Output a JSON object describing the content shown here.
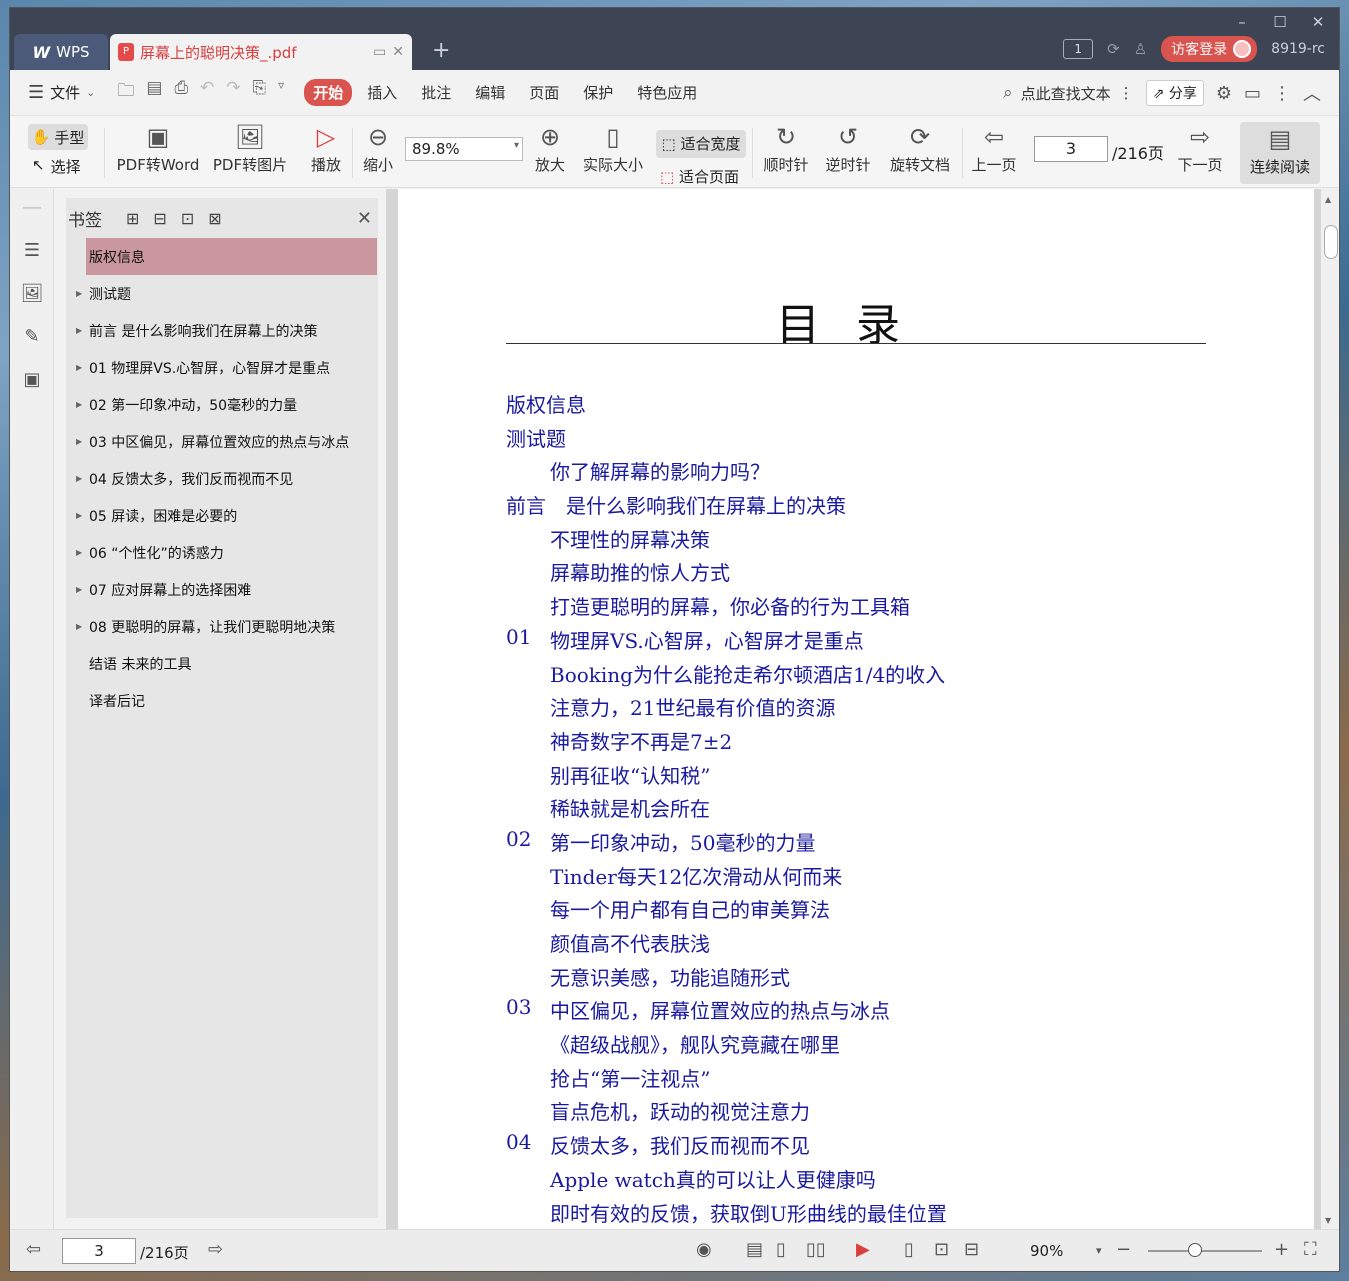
{
  "titlebar": {
    "app_tab": "WPS",
    "doc_tab": "屏幕上的聪明决策_.pdf",
    "page_badge": "1",
    "login": "访客登录",
    "user": "8919-rc"
  },
  "menubar": {
    "file": "文件",
    "menus": [
      "开始",
      "插入",
      "批注",
      "编辑",
      "页面",
      "保护",
      "特色应用"
    ],
    "active_menu": "开始",
    "search": "点此查找文本",
    "share": "分享"
  },
  "toolbar": {
    "hand": "手型",
    "select": "选择",
    "pdf2word": "PDF转Word",
    "pdf2img": "PDF转图片",
    "play": "播放",
    "zoom_out": "缩小",
    "zoom_value": "89.8%",
    "zoom_in": "放大",
    "actual_size": "实际大小",
    "fit_width": "适合宽度",
    "fit_page": "适合页面",
    "clockwise": "顺时针",
    "counter": "逆时针",
    "rotate_doc": "旋转文档",
    "prev": "上一页",
    "page": "3",
    "total": "/216页",
    "next": "下一页",
    "continuous": "连续阅读"
  },
  "bookmarks": {
    "title": "书签",
    "items": [
      {
        "label": "版权信息",
        "arrow": false,
        "selected": true
      },
      {
        "label": "测试题",
        "arrow": true
      },
      {
        "label": "前言 是什么影响我们在屏幕上的决策",
        "arrow": true
      },
      {
        "label": "01 物理屏VS.心智屏，心智屏才是重点",
        "arrow": true
      },
      {
        "label": "02 第一印象冲动，50毫秒的力量",
        "arrow": true
      },
      {
        "label": "03 中区偏见，屏幕位置效应的热点与冰点",
        "arrow": true
      },
      {
        "label": "04 反馈太多，我们反而视而不见",
        "arrow": true
      },
      {
        "label": "05 屏读，困难是必要的",
        "arrow": true
      },
      {
        "label": "06 “个性化”的诱惑力",
        "arrow": true
      },
      {
        "label": "07 应对屏幕上的选择困难",
        "arrow": true
      },
      {
        "label": "08 更聪明的屏幕，让我们更聪明地决策",
        "arrow": true
      },
      {
        "label": "结语 未来的工具",
        "arrow": false
      },
      {
        "label": "译者后记",
        "arrow": false
      }
    ]
  },
  "document": {
    "title": "目录",
    "toc": [
      {
        "num": "",
        "text": "版权信息",
        "top": true
      },
      {
        "num": "",
        "text": "测试题",
        "top": true
      },
      {
        "num": "",
        "text": "你了解屏幕的影响力吗？"
      },
      {
        "num": "",
        "text": "前言　是什么影响我们在屏幕上的决策",
        "top": true
      },
      {
        "num": "",
        "text": "不理性的屏幕决策"
      },
      {
        "num": "",
        "text": "屏幕助推的惊人方式"
      },
      {
        "num": "",
        "text": "打造更聪明的屏幕，你必备的行为工具箱"
      },
      {
        "num": "01",
        "text": "物理屏VS.心智屏，心智屏才是重点"
      },
      {
        "num": "",
        "text": "Booking为什么能抢走希尔顿酒店1/4的收入"
      },
      {
        "num": "",
        "text": "注意力，21世纪最有价值的资源"
      },
      {
        "num": "",
        "text": "神奇数字不再是7±2"
      },
      {
        "num": "",
        "text": "别再征收“认知税”"
      },
      {
        "num": "",
        "text": "稀缺就是机会所在"
      },
      {
        "num": "02",
        "text": "第一印象冲动，50毫秒的力量"
      },
      {
        "num": "",
        "text": "Tinder每天12亿次滑动从何而来"
      },
      {
        "num": "",
        "text": "每一个用户都有自己的审美算法"
      },
      {
        "num": "",
        "text": "颜值高不代表肤浅"
      },
      {
        "num": "",
        "text": "无意识美感，功能追随形式"
      },
      {
        "num": "03",
        "text": "中区偏见，屏幕位置效应的热点与冰点"
      },
      {
        "num": "",
        "text": "《超级战舰》，舰队究竟藏在哪里"
      },
      {
        "num": "",
        "text": "抢占“第一注视点”"
      },
      {
        "num": "",
        "text": "盲点危机，跃动的视觉注意力"
      },
      {
        "num": "04",
        "text": "反馈太多，我们反而视而不见"
      },
      {
        "num": "",
        "text": "Apple watch真的可以让人更健康吗"
      },
      {
        "num": "",
        "text": "即时有效的反馈，获取倒U形曲线的最佳位置"
      }
    ]
  },
  "statusbar": {
    "page": "3",
    "total": "/216页",
    "zoom": "90%"
  }
}
